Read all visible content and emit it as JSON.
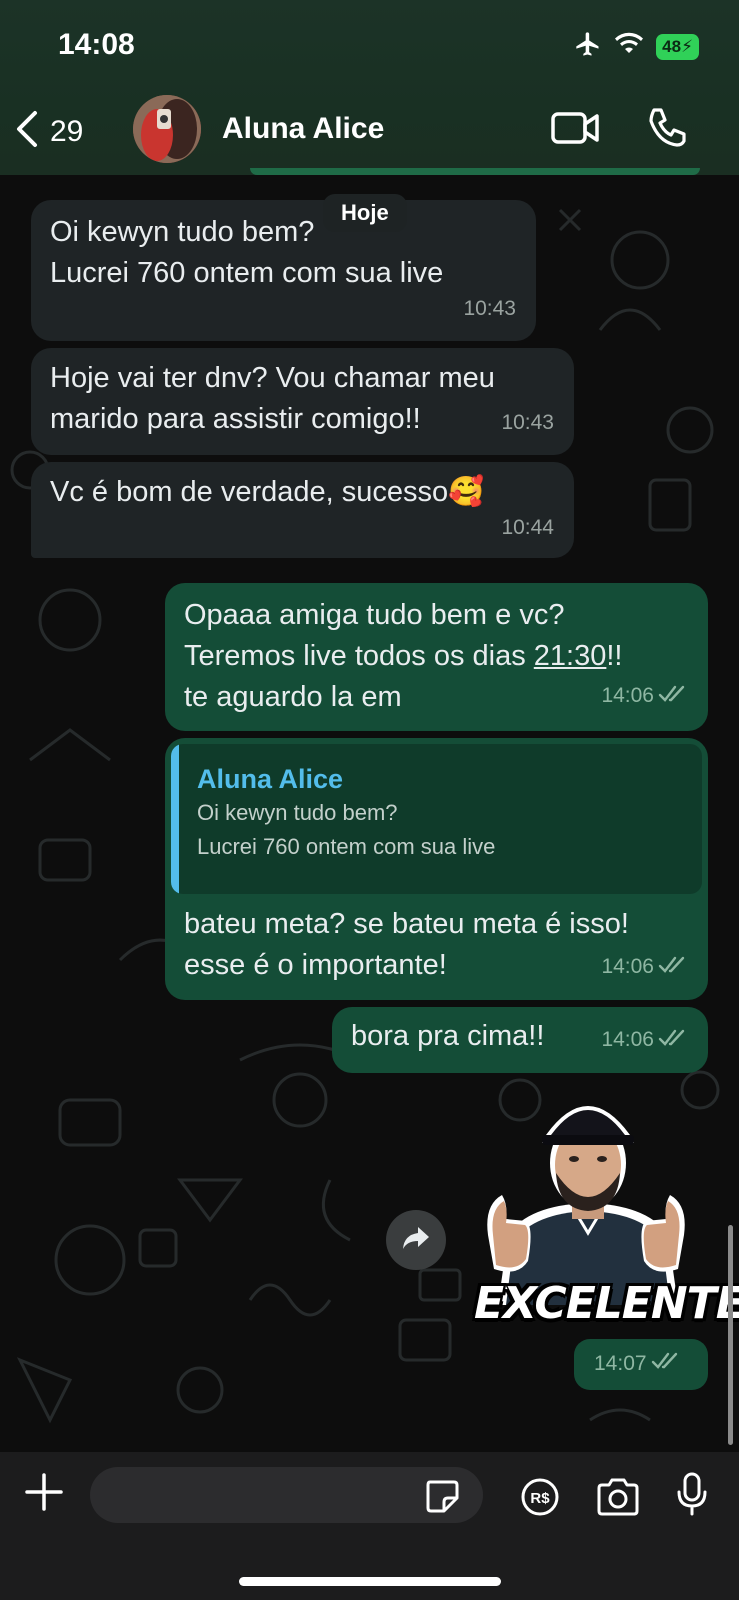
{
  "status_bar": {
    "time": "14:08",
    "battery": "48"
  },
  "header": {
    "back_count": "29",
    "contact_name": "Aluna Alice"
  },
  "date_separator": "Hoje",
  "messages": [
    {
      "direction": "in",
      "lines": [
        "Oi kewyn tudo bem?",
        "Lucrei 760 ontem com sua live"
      ],
      "time": "10:43"
    },
    {
      "direction": "in",
      "lines": [
        "Hoje vai ter dnv? Vou chamar meu",
        "marido para assistir comigo!!"
      ],
      "time": "10:43"
    },
    {
      "direction": "in",
      "lines": [
        "Vc é bom de verdade, sucesso🥰"
      ],
      "time": "10:44"
    },
    {
      "direction": "out",
      "lines": [
        "Opaaa amiga tudo bem e vc?",
        "Teremos live todos os dias ",
        "21:30",
        "!!",
        "te aguardo la em"
      ],
      "time": "14:06"
    },
    {
      "direction": "out",
      "reply": {
        "name": "Aluna Alice",
        "lines": [
          "Oi kewyn tudo bem?",
          "Lucrei 760 ontem com sua live"
        ]
      },
      "lines": [
        "bateu meta? se bateu meta é isso!",
        "esse é o importante!"
      ],
      "time": "14:06"
    },
    {
      "direction": "out",
      "lines": [
        "bora pra cima!!"
      ],
      "time": "14:06"
    },
    {
      "direction": "out",
      "type": "sticker",
      "caption": "EXCELENTE",
      "time": "14:07"
    }
  ],
  "composer": {
    "value": "",
    "placeholder": ""
  },
  "icons": {
    "back": "chevron-left-icon",
    "video": "video-call-icon",
    "call": "phone-icon",
    "forward": "forward-icon",
    "plus": "plus-icon",
    "sticker": "sticker-icon",
    "payment": "pix-payment-icon",
    "camera": "camera-icon",
    "mic": "microphone-icon"
  },
  "colors": {
    "outgoing": "#144d37",
    "incoming": "#1f2426",
    "reply_accent": "#53bdeb",
    "battery": "#30d158"
  }
}
